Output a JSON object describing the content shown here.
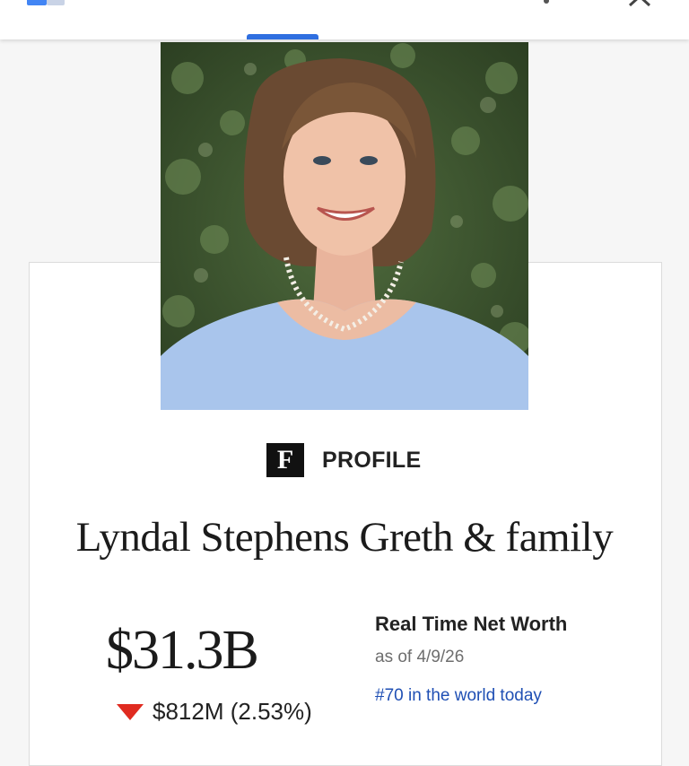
{
  "colors": {
    "accent": "#2f6fe0",
    "link": "#1f4fb4",
    "decline": "#e02b20",
    "text": "#1b1b1b",
    "muted": "#6e6e6e"
  },
  "topbar": {
    "app_icon": "google-app-icon",
    "more_icon": "overflow-menu-icon",
    "close_icon": "close-icon"
  },
  "profile": {
    "brand_letter": "F",
    "section_label": "PROFILE",
    "name": "Lyndal Stephens Greth & family",
    "photo_icon": "portrait-photo"
  },
  "net_worth": {
    "value": "$31.3B",
    "change": "$812M (2.53%)",
    "change_direction": "down",
    "title": "Real Time Net Worth",
    "as_of": "as of 4/9/26",
    "rank": "#70 in the world today"
  }
}
